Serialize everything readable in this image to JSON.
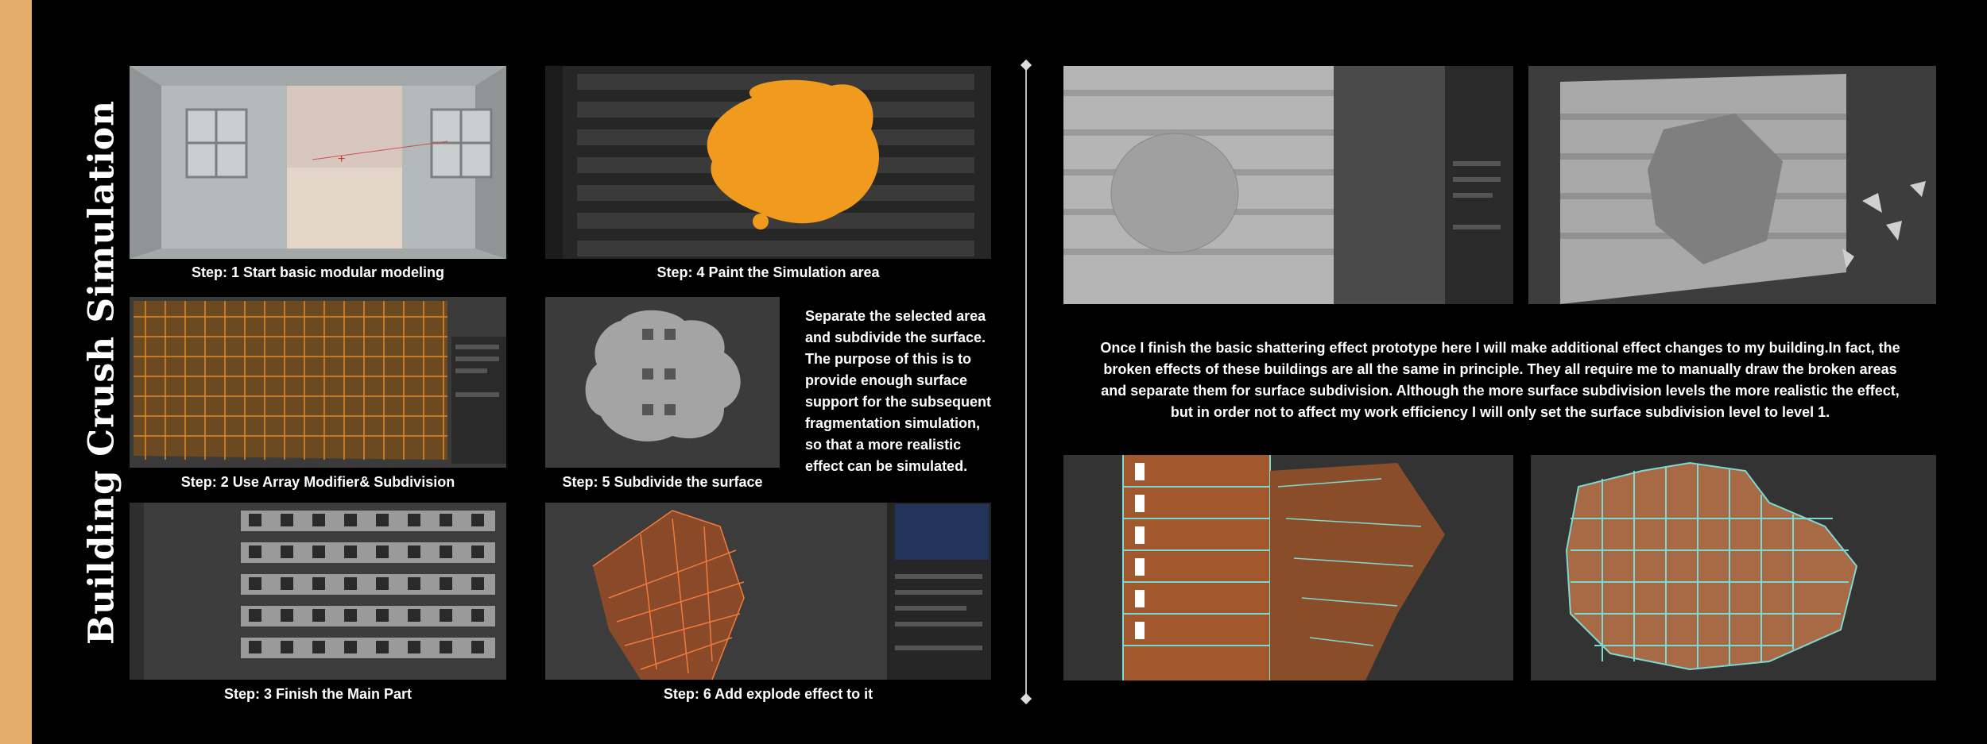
{
  "title": "Building Crush Simulation",
  "accent_color": "#e3ad6a",
  "wire_color": "#e08a2a",
  "left": {
    "steps": [
      {
        "caption": "Step: 1 Start basic modular modeling"
      },
      {
        "caption": "Step: 2 Use Array Modifier& Subdivision"
      },
      {
        "caption": "Step: 3 Finish the Main Part"
      },
      {
        "caption": "Step: 4 Paint the Simulation area"
      },
      {
        "caption": "Step: 5 Subdivide the surface"
      },
      {
        "caption": "Step: 6 Add explode effect to it"
      }
    ],
    "note": "Separate the selected area and subdivide the surface. The purpose of this is to provide enough surface support for the subsequent fragmentation simulation, so that a more realistic effect can be simulated."
  },
  "right": {
    "paragraph": "Once I finish the basic shattering effect prototype here I will make additional effect changes to my building.In fact, the broken effects of these buildings are all the same in principle. They all require me to manually draw the broken areas and separate them for surface subdivision. Although the more surface subdivision levels the more realistic the effect, but in order not to affect my work efficiency I will only set the surface subdivision level to level 1."
  }
}
